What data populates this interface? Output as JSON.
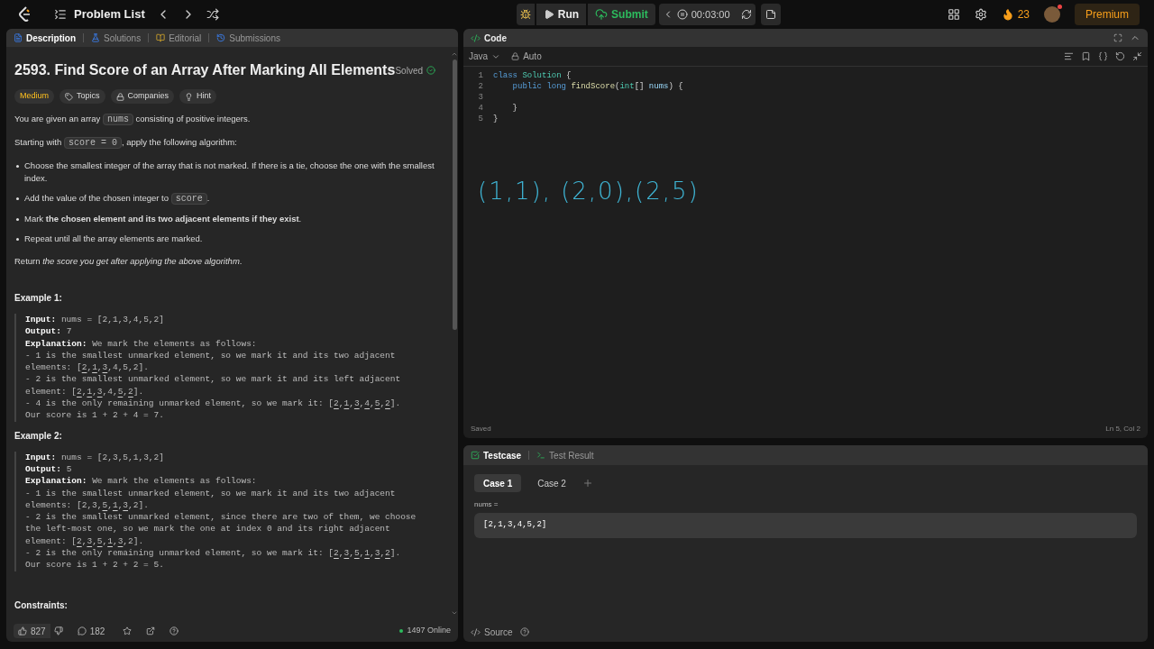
{
  "topbar": {
    "title": "Problem List",
    "run": "Run",
    "submit": "Submit",
    "timer": "00:03:00",
    "streak": "23",
    "premium": "Premium"
  },
  "description": {
    "tabs": [
      {
        "label": "Description",
        "selected": true
      },
      {
        "label": "Solutions",
        "selected": false
      },
      {
        "label": "Editorial",
        "selected": false
      },
      {
        "label": "Submissions",
        "selected": false
      }
    ],
    "title": "2593. Find Score of an Array After Marking All Elements",
    "status": "Solved",
    "tags": [
      {
        "label": "Medium",
        "kind": "difficulty"
      },
      {
        "label": "Topics",
        "kind": "tag"
      },
      {
        "label": "Companies",
        "kind": "lock"
      },
      {
        "label": "Hint",
        "kind": "bulb"
      }
    ],
    "intro": [
      {
        "kind": "para",
        "parts": [
          {
            "t": "You are given an array ",
            "code": false
          },
          {
            "t": "nums",
            "code": true
          },
          {
            "t": " consisting of positive integers.",
            "code": false
          }
        ]
      },
      {
        "kind": "para",
        "parts": [
          {
            "t": "Starting with ",
            "code": false
          },
          {
            "t": "score = 0",
            "code": true
          },
          {
            "t": ", apply the following algorithm:",
            "code": false
          }
        ]
      },
      {
        "kind": "list",
        "items": [
          [
            {
              "t": "Choose the smallest integer of the array that is not marked. If there is a tie, choose the one with the smallest index.",
              "code": false
            }
          ],
          [
            {
              "t": "Add the value of the chosen integer to ",
              "code": false
            },
            {
              "t": "score",
              "code": true
            },
            {
              "t": ".",
              "code": false
            }
          ],
          [
            {
              "t": "Mark **the chosen element and its two adjacent elements if they exist**.",
              "code": false
            }
          ],
          [
            {
              "t": "Repeat until all the array elements are marked.",
              "code": false
            }
          ]
        ]
      },
      {
        "kind": "para",
        "parts": [
          {
            "t": "Return *the score you get after applying the above algorithm*.",
            "code": false
          }
        ]
      }
    ],
    "examples": [
      {
        "title": "Example 1:",
        "input_label": "Input:",
        "input": "nums = [2,1,3,4,5,2]",
        "output_label": "Output:",
        "output": "7",
        "explanation_label": "Explanation:",
        "explanation": "We mark the elements as follows:",
        "lines": [
          {
            "parts": [
              {
                "t": "- 1 is the smallest unmarked element, so we mark it and its two adjacent elements: [",
                "marked": false
              },
              {
                "t": "2",
                "marked": true
              },
              {
                "t": ",",
                "marked": false
              },
              {
                "t": "1",
                "marked": true
              },
              {
                "t": ",",
                "marked": false
              },
              {
                "t": "3",
                "marked": true
              },
              {
                "t": ",4,5,2].",
                "marked": false
              }
            ]
          },
          {
            "parts": [
              {
                "t": "- 2 is the smallest unmarked element, so we mark it and its left adjacent element: [",
                "marked": false
              },
              {
                "t": "2",
                "marked": true
              },
              {
                "t": ",",
                "marked": false
              },
              {
                "t": "1",
                "marked": true
              },
              {
                "t": ",",
                "marked": false
              },
              {
                "t": "3",
                "marked": true
              },
              {
                "t": ",4,",
                "marked": false
              },
              {
                "t": "5",
                "marked": true
              },
              {
                "t": ",",
                "marked": false
              },
              {
                "t": "2",
                "marked": true
              },
              {
                "t": "].",
                "marked": false
              }
            ]
          },
          {
            "parts": [
              {
                "t": "- 4 is the only remaining unmarked element, so we mark it: [",
                "marked": false
              },
              {
                "t": "2",
                "marked": true
              },
              {
                "t": ",",
                "marked": false
              },
              {
                "t": "1",
                "marked": true
              },
              {
                "t": ",",
                "marked": false
              },
              {
                "t": "3",
                "marked": true
              },
              {
                "t": ",",
                "marked": false
              },
              {
                "t": "4",
                "marked": true
              },
              {
                "t": ",",
                "marked": false
              },
              {
                "t": "5",
                "marked": true
              },
              {
                "t": ",",
                "marked": false
              },
              {
                "t": "2",
                "marked": true
              },
              {
                "t": "].",
                "marked": false
              }
            ]
          },
          {
            "parts": [
              {
                "t": "Our score is 1 + 2 + 4 = 7.",
                "marked": false
              }
            ]
          }
        ]
      },
      {
        "title": "Example 2:",
        "input_label": "Input:",
        "input": "nums = [2,3,5,1,3,2]",
        "output_label": "Output:",
        "output": "5",
        "explanation_label": "Explanation:",
        "explanation": "We mark the elements as follows:",
        "lines": [
          {
            "parts": [
              {
                "t": "- 1 is the smallest unmarked element, so we mark it and its two adjacent elements: [2,3,",
                "marked": false
              },
              {
                "t": "5",
                "marked": true
              },
              {
                "t": ",",
                "marked": false
              },
              {
                "t": "1",
                "marked": true
              },
              {
                "t": ",",
                "marked": false
              },
              {
                "t": "3",
                "marked": true
              },
              {
                "t": ",2].",
                "marked": false
              }
            ]
          },
          {
            "parts": [
              {
                "t": "- 2 is the smallest unmarked element, since there are two of them, we choose the left-most one, so we mark the one at index 0 and its right adjacent element: [",
                "marked": false
              },
              {
                "t": "2",
                "marked": true
              },
              {
                "t": ",",
                "marked": false
              },
              {
                "t": "3",
                "marked": true
              },
              {
                "t": ",",
                "marked": false
              },
              {
                "t": "5",
                "marked": true
              },
              {
                "t": ",",
                "marked": false
              },
              {
                "t": "1",
                "marked": true
              },
              {
                "t": ",",
                "marked": false
              },
              {
                "t": "3",
                "marked": true
              },
              {
                "t": ",2].",
                "marked": false
              }
            ]
          },
          {
            "parts": [
              {
                "t": "- 2 is the only remaining unmarked element, so we mark it: [",
                "marked": false
              },
              {
                "t": "2",
                "marked": true
              },
              {
                "t": ",",
                "marked": false
              },
              {
                "t": "3",
                "marked": true
              },
              {
                "t": ",",
                "marked": false
              },
              {
                "t": "5",
                "marked": true
              },
              {
                "t": ",",
                "marked": false
              },
              {
                "t": "1",
                "marked": true
              },
              {
                "t": ",",
                "marked": false
              },
              {
                "t": "3",
                "marked": true
              },
              {
                "t": ",",
                "marked": false
              },
              {
                "t": "2",
                "marked": true
              },
              {
                "t": "].",
                "marked": false
              }
            ]
          },
          {
            "parts": [
              {
                "t": "Our score is 1 + 2 + 2 = 5.",
                "marked": false
              }
            ]
          }
        ]
      }
    ],
    "constraints": "Constraints:",
    "footer": {
      "likes": "827",
      "comments": "182",
      "online": "1497 Online"
    }
  },
  "code": {
    "title": "Code",
    "language": "Java",
    "mode": "Auto",
    "lines": [
      {
        "number": "1",
        "tokens": [
          {
            "t": "class ",
            "kind": "kw"
          },
          {
            "t": "Solution",
            "kind": "type"
          },
          {
            "t": " {",
            "kind": "plain"
          }
        ]
      },
      {
        "number": "2",
        "tokens": [
          {
            "t": "    public long ",
            "kind": "kw"
          },
          {
            "t": "findScore",
            "kind": "fn"
          },
          {
            "t": "(",
            "kind": "plain"
          },
          {
            "t": "int",
            "kind": "kw2"
          },
          {
            "t": "[] ",
            "kind": "plain"
          },
          {
            "t": "nums",
            "kind": "var"
          },
          {
            "t": ") {",
            "kind": "plain"
          }
        ]
      },
      {
        "number": "3"
      },
      {
        "number": "4",
        "tokens": [
          {
            "t": "    }",
            "kind": "plain"
          }
        ]
      },
      {
        "number": "5",
        "tokens": [
          {
            "t": "}",
            "kind": "plain"
          }
        ]
      }
    ],
    "annotation": "(1,1), (2,0),(2,5)",
    "status": "Saved",
    "cursor": "Ln 5, Col 2"
  },
  "testcase": {
    "tabs": [
      {
        "label": "Testcase",
        "selected": true
      },
      {
        "label": "Test Result",
        "selected": false
      }
    ],
    "cases": [
      {
        "label": "Case 1",
        "selected": true
      },
      {
        "label": "Case 2",
        "selected": false
      }
    ],
    "param": "nums =",
    "value": "[2,1,3,4,5,2]",
    "source": "Source"
  }
}
